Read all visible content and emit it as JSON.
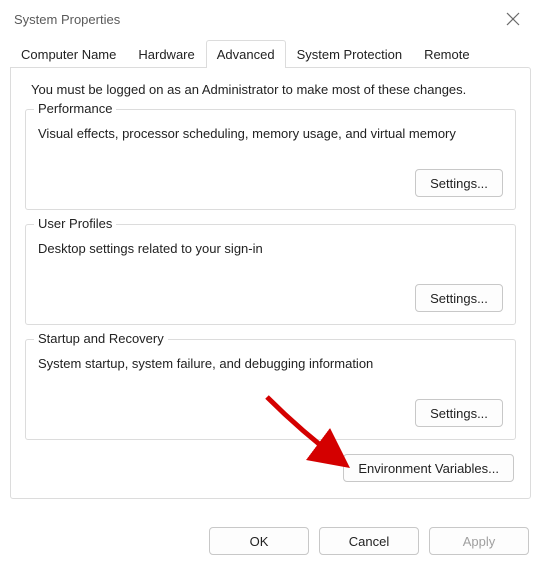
{
  "window": {
    "title": "System Properties"
  },
  "tabs": {
    "items": [
      {
        "label": "Computer Name"
      },
      {
        "label": "Hardware"
      },
      {
        "label": "Advanced"
      },
      {
        "label": "System Protection"
      },
      {
        "label": "Remote"
      }
    ],
    "active_index": 2
  },
  "advanced": {
    "intro": "You must be logged on as an Administrator to make most of these changes.",
    "performance": {
      "legend": "Performance",
      "desc": "Visual effects, processor scheduling, memory usage, and virtual memory",
      "settings_label": "Settings..."
    },
    "userprofiles": {
      "legend": "User Profiles",
      "desc": "Desktop settings related to your sign-in",
      "settings_label": "Settings..."
    },
    "startup": {
      "legend": "Startup and Recovery",
      "desc": "System startup, system failure, and debugging information",
      "settings_label": "Settings..."
    },
    "env_vars_label": "Environment Variables..."
  },
  "buttons": {
    "ok": "OK",
    "cancel": "Cancel",
    "apply": "Apply"
  }
}
